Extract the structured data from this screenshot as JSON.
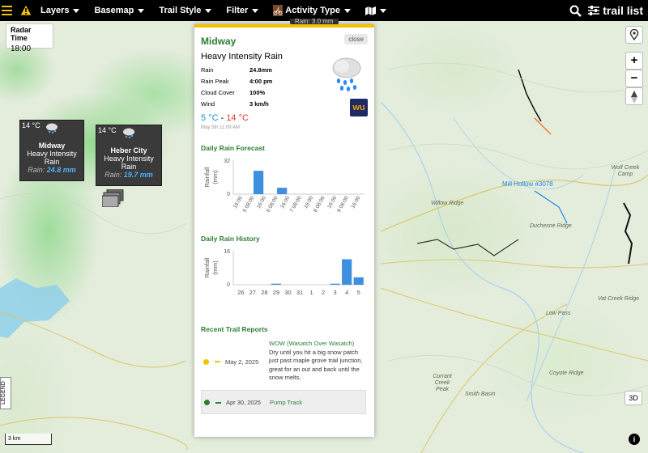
{
  "topbar": {
    "menu": [
      {
        "label": "Layers"
      },
      {
        "label": "Basemap"
      },
      {
        "label": "Trail Style"
      },
      {
        "label": "Filter"
      },
      {
        "label": "Activity Type"
      }
    ],
    "trail_list_label": "trail list",
    "radar_tag": "Rain: 3.0 mm"
  },
  "radar_time": {
    "label": "Radar Time",
    "value": "18:00"
  },
  "stations": [
    {
      "temp": "14 °C",
      "name": "Midway",
      "cond": "Heavy Intensity Rain",
      "rain_label": "Rain:",
      "rain_value": "24.8 mm"
    },
    {
      "temp": "14 °C",
      "name": "Heber City",
      "cond": "Heavy Intensity Rain",
      "rain_label": "Rain:",
      "rain_value": "19.7 mm"
    }
  ],
  "popup": {
    "title": "Midway",
    "close_label": "close",
    "condition": "Heavy Intensity Rain",
    "stats": [
      {
        "k": "Rain",
        "v": "24.8mm"
      },
      {
        "k": "Rain Peak",
        "v": "4:00 pm"
      },
      {
        "k": "Cloud Cover",
        "v": "100%"
      },
      {
        "k": "Wind",
        "v": "3 km/h"
      }
    ],
    "temp_low": "5 °C",
    "temp_sep": " - ",
    "temp_high": "14 °C",
    "date": "May 5th 11:09 AM",
    "logo_text": "wu",
    "forecast_title": "Daily Rain Forecast",
    "history_title": "Daily Rain History",
    "reports_title": "Recent Trail Reports",
    "reports": [
      {
        "date": "May 2, 2025",
        "title": "WOW (Wasatch Over Wasatch)",
        "text": "Dry until you hit a big snow patch just past maple grove trail junction, great for an out and back until the snow melts.",
        "status": "yellow"
      },
      {
        "date": "Apr 30, 2025",
        "title": "Pump Track",
        "text": "",
        "status": "green"
      }
    ]
  },
  "chart_data": [
    {
      "type": "bar",
      "title": "Daily Rain Forecast",
      "ylabel": "Rainfall (mm)",
      "ylim": [
        0,
        32
      ],
      "yticks": [
        "32",
        "0"
      ],
      "categories": [
        "16:00",
        "5 08:00",
        "16:00",
        "6 08:00",
        "16:00",
        "7 08:00",
        "16:00",
        "8 08:00",
        "16:00",
        "9 08:00",
        "16:00"
      ],
      "values": [
        0,
        22,
        0,
        6,
        0,
        0,
        0,
        0,
        0,
        0,
        0
      ]
    },
    {
      "type": "bar",
      "title": "Daily Rain History",
      "ylabel": "Rainfall (mm)",
      "ylim": [
        0,
        16
      ],
      "yticks": [
        "16",
        "0"
      ],
      "categories": [
        "26",
        "27",
        "28",
        "29",
        "30",
        "31",
        "1",
        "2",
        "3",
        "4",
        "5"
      ],
      "values": [
        0,
        0,
        0,
        0.5,
        0,
        0,
        0,
        0,
        0.5,
        12,
        3.5
      ]
    }
  ],
  "map": {
    "trail_label": "Mill Hollow #3078",
    "labels": [
      "Willow Ridge",
      "Duchesne Ridge",
      "Low Pass",
      "Vat Creek Ridge",
      "Coyote Ridge",
      "Smith Basin",
      "Currant Creek Peak",
      "Wolf Creek Camp"
    ],
    "scale_label": "3 km",
    "legend_label": "LEGEND",
    "btn_3d": "3D"
  }
}
